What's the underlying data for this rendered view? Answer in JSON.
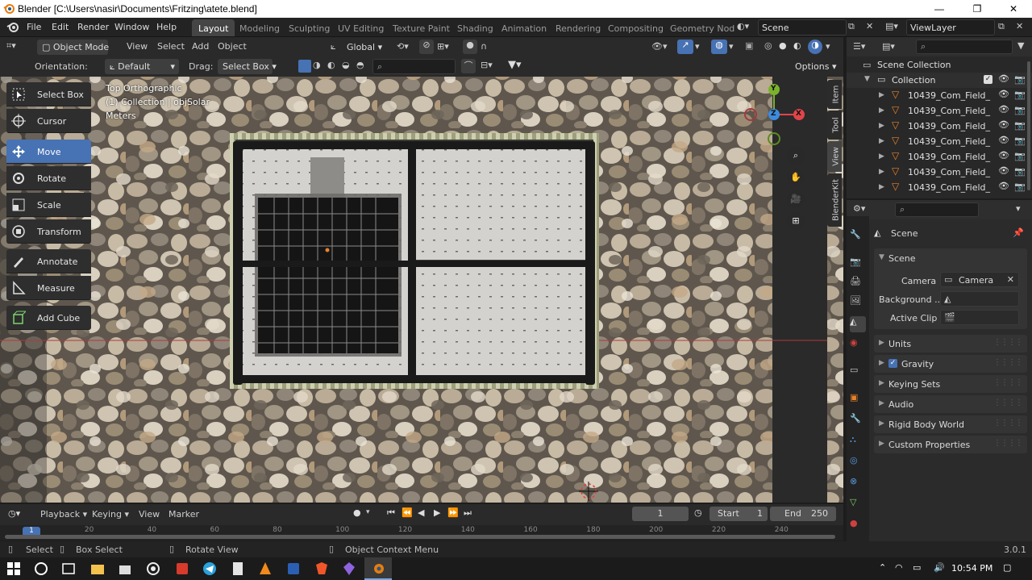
{
  "window": {
    "title": "Blender [C:\\Users\\nasir\\Documents\\Fritzing\\atete.blend]"
  },
  "menus": [
    "File",
    "Edit",
    "Render",
    "Window",
    "Help"
  ],
  "workspaces": [
    "Layout",
    "Modeling",
    "Sculpting",
    "UV Editing",
    "Texture Paint",
    "Shading",
    "Animation",
    "Rendering",
    "Compositing",
    "Geometry Nod"
  ],
  "scene_field": "Scene",
  "viewlayer_field": "ViewLayer",
  "header": {
    "mode": "Object Mode",
    "view": "View",
    "select": "Select",
    "add": "Add",
    "object": "Object",
    "transform": "Global"
  },
  "toolsettings": {
    "orientation_label": "Orientation:",
    "orientation_value": "Default",
    "drag_label": "Drag:",
    "drag_value": "Select Box",
    "options": "Options"
  },
  "tools": [
    "Select Box",
    "Cursor",
    "Move",
    "Rotate",
    "Scale",
    "Transform",
    "Annotate",
    "Measure",
    "Add Cube"
  ],
  "overlay": {
    "line1": "Top Orthographic",
    "line2": "(1) Collection | objSolar",
    "line3": "Meters"
  },
  "gizmo": {
    "y": "Y",
    "z": "Z",
    "x": "X"
  },
  "sidebar_tabs": [
    "Item",
    "Tool",
    "View",
    "BlenderKit"
  ],
  "outliner": {
    "root": "Scene Collection",
    "collection": "Collection",
    "items": [
      "10439_Com_Field_",
      "10439_Com_Field_",
      "10439_Com_Field_",
      "10439_Com_Field_",
      "10439_Com_Field_",
      "10439_Com_Field_",
      "10439_Com_Field_"
    ]
  },
  "properties": {
    "title": "Scene",
    "section": "Scene",
    "camera_label": "Camera",
    "camera_value": "Camera",
    "background_label": "Background ...",
    "active_clip_label": "Active Clip",
    "panels": [
      "Units",
      "Gravity",
      "Keying Sets",
      "Audio",
      "Rigid Body World",
      "Custom Properties"
    ]
  },
  "timeline": {
    "playback": "Playback",
    "keying": "Keying",
    "view": "View",
    "marker": "Marker",
    "current_frame": "1",
    "start_label": "Start",
    "start": "1",
    "end_label": "End",
    "end": "250",
    "ruler": [
      "1",
      "20",
      "40",
      "60",
      "80",
      "100",
      "120",
      "140",
      "160",
      "180",
      "200",
      "220",
      "240"
    ]
  },
  "status": {
    "select": "Select",
    "box_select": "Box Select",
    "rotate_view": "Rotate View",
    "context_menu": "Object Context Menu",
    "version": "3.0.1"
  },
  "taskbar": {
    "time": "10:54 PM"
  },
  "colors": {
    "accent": "#4772b3",
    "x_axis": "#e0444a",
    "y_axis": "#7bb22c",
    "z_axis": "#3c8be0",
    "active_orange": "#e8822a"
  }
}
